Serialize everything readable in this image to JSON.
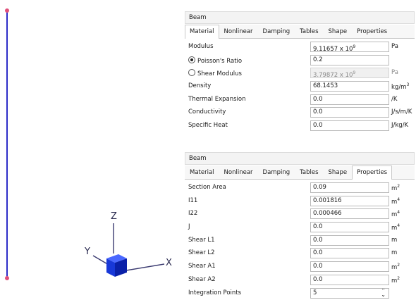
{
  "viewport": {
    "axes": {
      "x_label": "X",
      "y_label": "Y",
      "z_label": "Z"
    },
    "colors": {
      "beam": "#2d2dc8",
      "node": "#e0507a",
      "box": "#1f3fe0"
    }
  },
  "panel1": {
    "title": "Beam",
    "tabs": [
      "Material",
      "Nonlinear",
      "Damping",
      "Tables",
      "Shape",
      "Properties"
    ],
    "active_tab": "Material",
    "rows": {
      "modulus": {
        "label": "Modulus",
        "value_base": "9.11657 x 10",
        "value_exp": "9",
        "unit": "Pa"
      },
      "poisson": {
        "label": "Poisson's Ratio",
        "value": "0.2",
        "unit": ""
      },
      "shear_modulus": {
        "label": "Shear Modulus",
        "value_base": "3.79872 x 10",
        "value_exp": "9",
        "unit": "Pa"
      },
      "density": {
        "label": "Density",
        "value": "68.1453",
        "unit_base": "kg/m",
        "unit_exp": "3"
      },
      "thermal_expansion": {
        "label": "Thermal Expansion",
        "value": "0.0",
        "unit": "/K"
      },
      "conductivity": {
        "label": "Conductivity",
        "value": "0.0",
        "unit": "J/s/m/K"
      },
      "specific_heat": {
        "label": "Specific Heat",
        "value": "0.0",
        "unit": "J/kg/K"
      }
    },
    "poisson_selected": true
  },
  "panel2": {
    "title": "Beam",
    "tabs": [
      "Material",
      "Nonlinear",
      "Damping",
      "Tables",
      "Shape",
      "Properties"
    ],
    "active_tab": "Properties",
    "rows": {
      "section_area": {
        "label": "Section Area",
        "value": "0.09",
        "unit_base": "m",
        "unit_exp": "2"
      },
      "i11": {
        "label": "I11",
        "value": "0.001816",
        "unit_base": "m",
        "unit_exp": "4"
      },
      "i22": {
        "label": "I22",
        "value": "0.000466",
        "unit_base": "m",
        "unit_exp": "4"
      },
      "j": {
        "label": "J",
        "value": "0.0",
        "unit_base": "m",
        "unit_exp": "4"
      },
      "shear_l1": {
        "label": "Shear L1",
        "value": "0.0",
        "unit": "m"
      },
      "shear_l2": {
        "label": "Shear L2",
        "value": "0.0",
        "unit": "m"
      },
      "shear_a1": {
        "label": "Shear A1",
        "value": "0.0",
        "unit_base": "m",
        "unit_exp": "2"
      },
      "shear_a2": {
        "label": "Shear A2",
        "value": "0.0",
        "unit_base": "m",
        "unit_exp": "2"
      },
      "integration_points": {
        "label": "Integration Points",
        "value": "5"
      }
    }
  }
}
